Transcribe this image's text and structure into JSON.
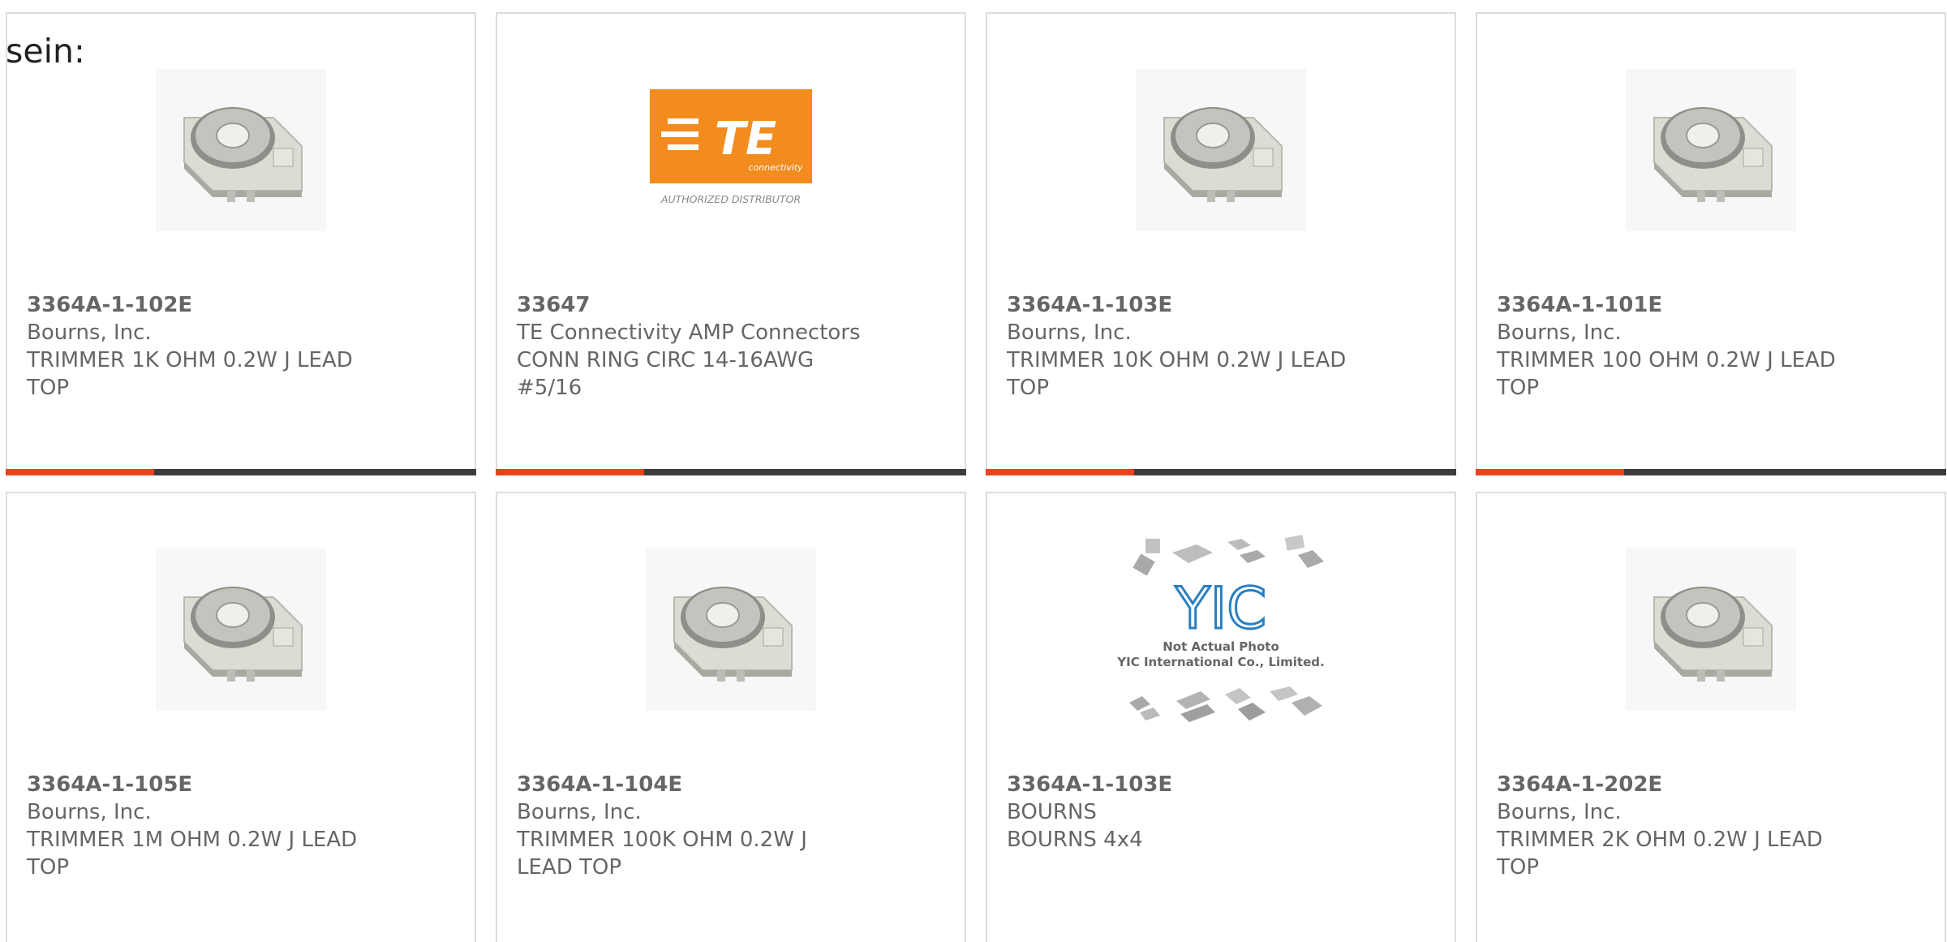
{
  "intro_text": "sein:",
  "colors": {
    "accent": "#e8431a",
    "bar_dark": "#3c3c3c",
    "border": "#dcdcdc",
    "text": "#666666"
  },
  "products": [
    {
      "part_number": "3364A-1-102E",
      "manufacturer": "Bourns, Inc.",
      "description": "TRIMMER 1K OHM 0.2W J LEAD TOP",
      "image": "trimmer-pot"
    },
    {
      "part_number": "33647",
      "manufacturer": "TE Connectivity AMP Connectors",
      "description": "CONN RING CIRC 14-16AWG #5/16",
      "image": "te-logo",
      "logo_text": "TE",
      "logo_sub": "connectivity",
      "logo_caption": "AUTHORIZED DISTRIBUTOR"
    },
    {
      "part_number": "3364A-1-103E",
      "manufacturer": "Bourns, Inc.",
      "description": "TRIMMER 10K OHM 0.2W J LEAD TOP",
      "image": "trimmer-pot"
    },
    {
      "part_number": "3364A-1-101E",
      "manufacturer": "Bourns, Inc.",
      "description": "TRIMMER 100 OHM 0.2W J LEAD TOP",
      "image": "trimmer-pot"
    },
    {
      "part_number": "3364A-1-105E",
      "manufacturer": "Bourns, Inc.",
      "description": "TRIMMER 1M OHM 0.2W J LEAD TOP",
      "image": "trimmer-pot"
    },
    {
      "part_number": "3364A-1-104E",
      "manufacturer": "Bourns, Inc.",
      "description": "TRIMMER 100K OHM 0.2W J LEAD TOP",
      "image": "trimmer-pot"
    },
    {
      "part_number": "3364A-1-103E",
      "manufacturer": "BOURNS",
      "description": "BOURNS 4x4",
      "image": "yic-placeholder",
      "logo_text": "YIC",
      "caption_line1": "Not Actual Photo",
      "caption_line2": "YIC International Co., Limited."
    },
    {
      "part_number": "3364A-1-202E",
      "manufacturer": "Bourns, Inc.",
      "description": "TRIMMER 2K OHM 0.2W J LEAD TOP",
      "image": "trimmer-pot"
    }
  ]
}
